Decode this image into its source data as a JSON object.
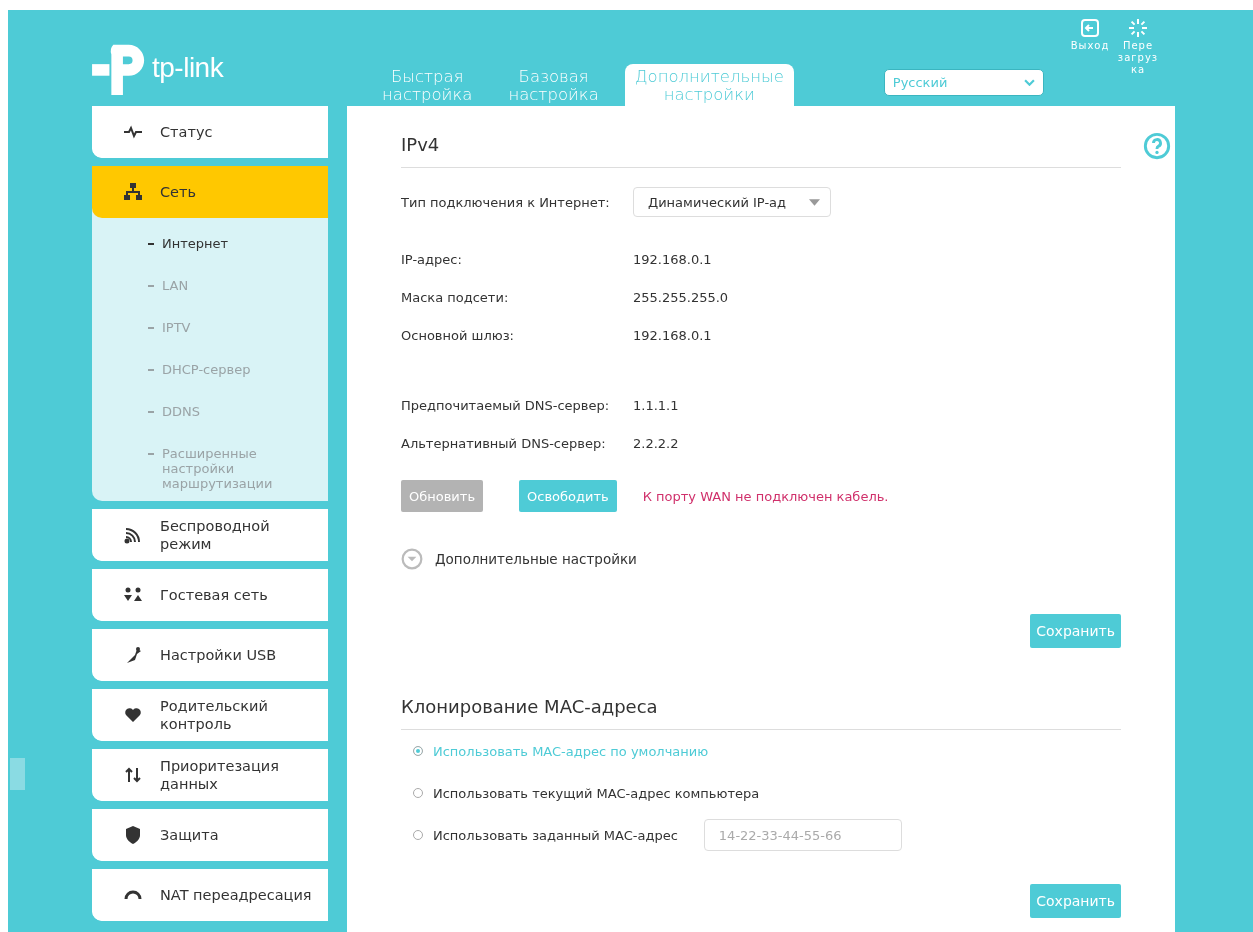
{
  "header": {
    "logo": "tp-link",
    "tabs": [
      {
        "lines": [
          "Быстрая",
          "настройка"
        ],
        "selected": false
      },
      {
        "lines": [
          "Базовая",
          "настройка"
        ],
        "selected": false
      },
      {
        "lines": [
          "Дополнительные",
          "настройки"
        ],
        "selected": true
      }
    ],
    "language": {
      "value": "Русский"
    },
    "actions": [
      {
        "kind": "logout",
        "lines": [
          "Выход"
        ]
      },
      {
        "kind": "reboot",
        "lines": [
          "Пере",
          "загруз",
          "ка"
        ]
      }
    ]
  },
  "sidebar": {
    "items": [
      {
        "lines": [
          "Статус"
        ],
        "selected": false
      },
      {
        "lines": [
          "Сеть"
        ],
        "selected": true,
        "expanded": true,
        "children": [
          {
            "lines": [
              "Интернет"
            ],
            "selected": true
          },
          {
            "lines": [
              "LAN"
            ],
            "selected": false
          },
          {
            "lines": [
              "IPTV"
            ],
            "selected": false
          },
          {
            "lines": [
              "DHCP-сервер"
            ],
            "selected": false
          },
          {
            "lines": [
              "DDNS"
            ],
            "selected": false
          },
          {
            "lines": [
              "Расширенные",
              "настройки",
              "маршрутизации"
            ],
            "selected": false
          }
        ]
      },
      {
        "lines": [
          "Беспроводной",
          "режим"
        ],
        "selected": false
      },
      {
        "lines": [
          "Гостевая сеть"
        ],
        "selected": false
      },
      {
        "lines": [
          "Настройки USB"
        ],
        "selected": false
      },
      {
        "lines": [
          "Родительский",
          "контроль"
        ],
        "selected": false
      },
      {
        "lines": [
          "Приоритезация",
          "данных"
        ],
        "selected": false
      },
      {
        "lines": [
          "Защита"
        ],
        "selected": false
      },
      {
        "lines": [
          "NAT переадресация"
        ],
        "selected": false
      }
    ]
  },
  "ipv4": {
    "title": "IPv4",
    "connection_type": {
      "label": "Тип подключения к Интернет:",
      "value": "Динамический IP-ад"
    },
    "groups": [
      [
        {
          "label": "IP-адрес:",
          "value": "192.168.0.1"
        },
        {
          "label": "Маска подсети:",
          "value": "255.255.255.0"
        },
        {
          "label": "Основной шлюз:",
          "value": "192.168.0.1"
        }
      ],
      [
        {
          "label": "Предпочитаемый DNS-сервер:",
          "value": "1.1.1.1"
        },
        {
          "label": "Альтернативный DNS-сервер:",
          "value": "2.2.2.2"
        }
      ]
    ],
    "buttons": [
      {
        "label": "Обновить",
        "disabled": true
      },
      {
        "label": "Освободить",
        "disabled": false
      }
    ],
    "error": "К порту WAN не подключен кабель.",
    "advanced": {
      "label": "Дополнительные настройки",
      "expanded": false
    },
    "save": "Сохранить"
  },
  "mac_clone": {
    "title": "Клонирование MAC-адреса",
    "options": [
      {
        "label": "Использовать MAC-адрес по умолчанию",
        "selected": true
      },
      {
        "label": "Использовать текущий MAC-адрес компьютера",
        "selected": false
      },
      {
        "label": "Использовать заданный MAC-адрес",
        "selected": false,
        "placeholder": "14-22-33-44-55-66"
      }
    ],
    "save": "Сохранить"
  }
}
